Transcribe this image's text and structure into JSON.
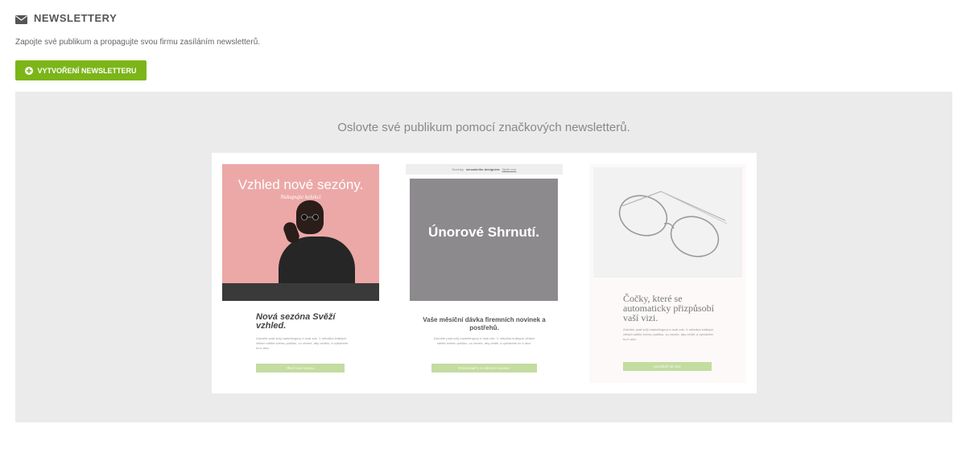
{
  "header": {
    "icon": "envelope-icon",
    "title": "NEWSLETTERY",
    "subtitle": "Zapojte své publikum a propagujte svou firmu zasíláním newsletterů."
  },
  "create_button": {
    "icon": "plus-circle-icon",
    "label": "VYTVOŘENÍ NEWSLETTERU",
    "color": "#7cb518"
  },
  "showcase": {
    "heading": "Oslovte své publikum pomocí značkových newsletterů.",
    "templates": [
      {
        "hero_title": "Vzhled nové sezóny.",
        "hero_subtitle": "Nakupujte kolekci",
        "heading": "Nová sezóna Svěží vzhled.",
        "body": "Začněte psát svůj marketingový e-mail zde. V několika krátkých větách sdělte svému publiku, co chcete, aby vědělo, a vybídněte ho k akci.",
        "button": "PŘEJÍT NA STRÁNKU",
        "hero_color": "#eca8a7"
      },
      {
        "topbar_prefix": "Novinky",
        "topbar_bold": "senzačního designéra",
        "topbar_link": "Zjistit více",
        "hero_title": "Únorové Shrnutí.",
        "heading": "Vaše měsíční dávka firemních novinek a postřehů.",
        "body": "Začněte psát svůj marketingový e-mail zde. V několika krátkých větách sdělte svému publiku, co chcete, aby věděl, a vybídněte ho k akci.",
        "button": "PROHLÉDNĚTE SI VŠECHNY NOVINKY",
        "hero_color": "#8d8a8e"
      },
      {
        "heading": "Čočky, které se automaticky přizpůsobí vaší vizi.",
        "body": "Začněte psát svůj marketingový e-mail zde. V několika krátkých větách sdělte svému publiku, co chcete, aby věděl, a vybídněte ho k akci.",
        "button": "DOZVĚDĚT SE VÍCE",
        "hero_color": "#f2f2f2"
      }
    ]
  },
  "colors": {
    "panel_bg": "#ebebeb",
    "template_button": "#c3dca0"
  }
}
